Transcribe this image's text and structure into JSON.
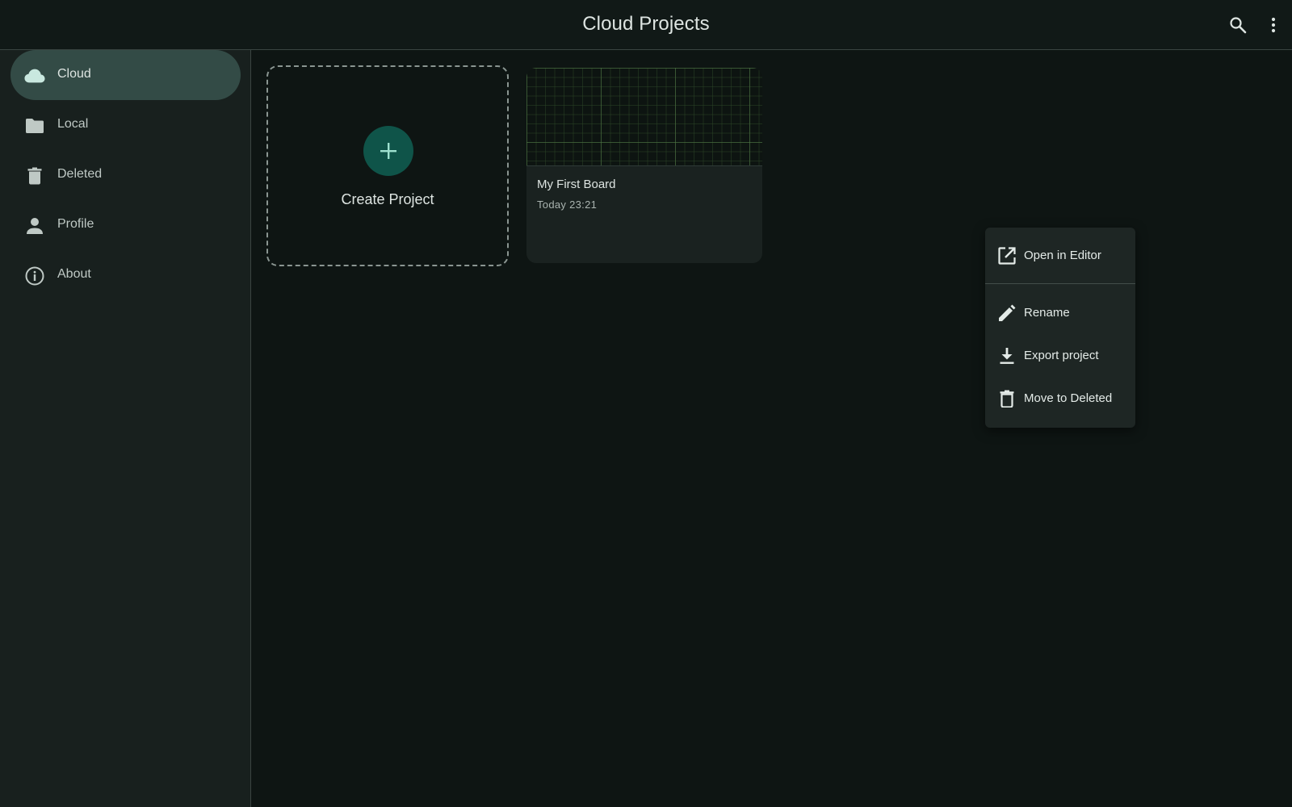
{
  "header": {
    "title": "Cloud Projects",
    "search_icon": "search-icon",
    "more_icon": "more-vert-icon"
  },
  "sidebar": {
    "items": [
      {
        "label": "Cloud",
        "icon": "cloud-icon",
        "active": true
      },
      {
        "label": "Local",
        "icon": "folder-icon",
        "active": false
      },
      {
        "label": "Deleted",
        "icon": "trash-icon",
        "active": false
      },
      {
        "label": "Profile",
        "icon": "person-icon",
        "active": false
      },
      {
        "label": "About",
        "icon": "info-icon",
        "active": false
      }
    ]
  },
  "main": {
    "create_card": {
      "label": "Create Project",
      "icon": "plus-icon"
    },
    "projects": [
      {
        "name": "My First Board",
        "date": "Today 23:21"
      }
    ]
  },
  "context_menu": {
    "items": [
      {
        "label": "Open in Editor",
        "icon": "open-in-new-icon"
      },
      {
        "label": "Rename",
        "icon": "pencil-icon"
      },
      {
        "label": "Export project",
        "icon": "download-icon"
      },
      {
        "label": "Move to Deleted",
        "icon": "trash-icon"
      }
    ]
  },
  "colors": {
    "background": "#0e1513",
    "sidebar": "#18201e",
    "active_nav": "#334b46",
    "fab": "#0f5449",
    "accent": "#9ee0cf"
  }
}
